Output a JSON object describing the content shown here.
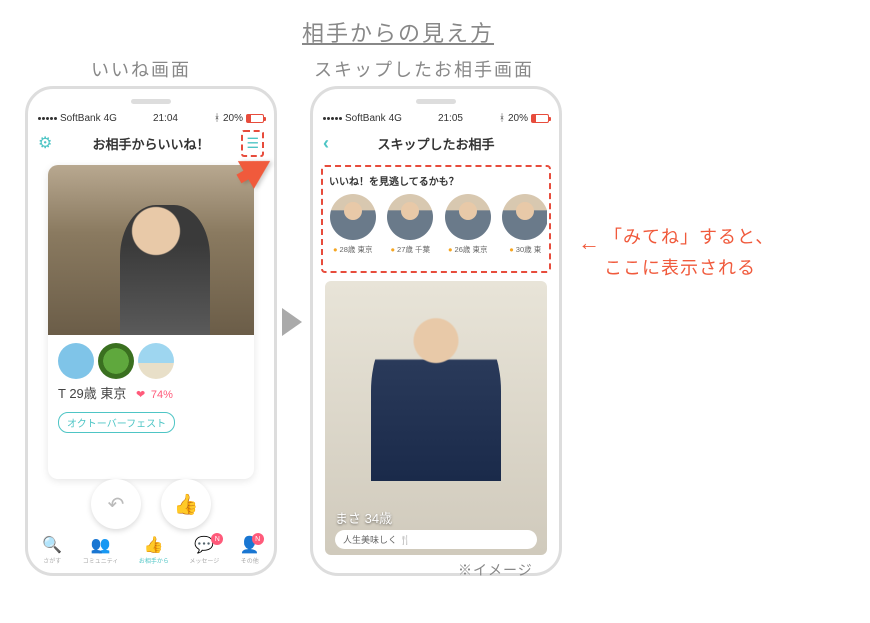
{
  "page_title": "相手からの見え方",
  "left_label": "いいね画面",
  "right_label": "スキップしたお相手画面",
  "note": "※イメージ",
  "callout": "「みてね」すると、\nここに表示される",
  "status": {
    "carrier": "SoftBank",
    "network": "4G",
    "time_left": "21:04",
    "time_right": "21:05",
    "batt_pct": "20%"
  },
  "left_screen": {
    "header_title": "お相手からいいね！",
    "profile_line": "T 29歳 東京",
    "match_pct": "74%",
    "tag": "オクトーバーフェスト",
    "tabs": {
      "search": "さがす",
      "community": "コミュニティ",
      "from_partner": "お相手から",
      "message": "メッセージ",
      "other": "その他",
      "badge": "N"
    }
  },
  "right_screen": {
    "header_title": "スキップしたお相手",
    "mitene_title": "いいね！を見逃してるかも？",
    "items": [
      {
        "meta": "28歳 東京"
      },
      {
        "meta": "27歳 千葉"
      },
      {
        "meta": "26歳 東京"
      },
      {
        "meta": "30歳 東"
      }
    ],
    "bigcard_name": "まさ 34歳",
    "bigcard_tag": "人生美味しく"
  }
}
